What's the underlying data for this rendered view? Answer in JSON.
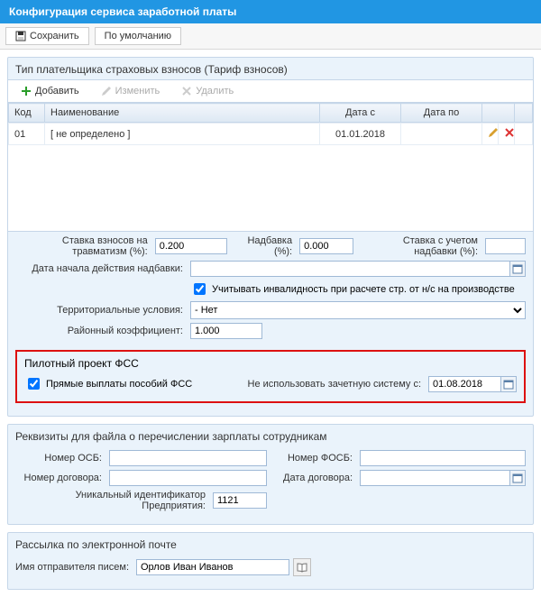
{
  "title": "Конфигурация сервиса заработной платы",
  "toolbar": {
    "save_label": "Сохранить",
    "default_label": "По умолчанию"
  },
  "payer_section": {
    "title": "Тип плательщика страховых взносов (Тариф взносов)",
    "add_label": "Добавить",
    "edit_label": "Изменить",
    "delete_label": "Удалить",
    "columns": {
      "code": "Код",
      "name": "Наименование",
      "date_from": "Дата с",
      "date_to": "Дата по"
    },
    "rows": [
      {
        "code": "01",
        "name": "[ не определено ]",
        "date_from": "01.01.2018",
        "date_to": ""
      }
    ]
  },
  "rates": {
    "injury_label": "Ставка взносов на травматизм (%):",
    "injury_value": "0.200",
    "surcharge_label": "Надбавка (%):",
    "surcharge_value": "0.000",
    "rate_with_surcharge_label": "Ставка с учетом надбавки (%):",
    "rate_with_surcharge_value": "",
    "surcharge_start_label": "Дата начала действия надбавки:",
    "surcharge_start_value": "",
    "disability_checkbox_label": "Учитывать инвалидность при расчете стр. от н/с на производстве",
    "terr_label": "Территориальные условия:",
    "terr_value": "- Нет",
    "district_coef_label": "Районный коэффициент:",
    "district_coef_value": "1.000"
  },
  "pilot": {
    "title": "Пилотный проект ФСС",
    "direct_payments_label": "Прямые выплаты пособий ФСС",
    "no_offset_label": "Не использовать зачетную систему с:",
    "no_offset_date": "01.08.2018"
  },
  "transfer": {
    "title": "Реквизиты для файла о перечислении зарплаты сотрудникам",
    "osb_label": "Номер ОСБ:",
    "osb_value": "",
    "fosb_label": "Номер ФОСБ:",
    "fosb_value": "",
    "contract_num_label": "Номер договора:",
    "contract_num_value": "",
    "contract_date_label": "Дата договора:",
    "contract_date_value": "",
    "enterprise_id_label": "Уникальный идентификатор Предприятия:",
    "enterprise_id_value": "1121"
  },
  "email": {
    "title": "Рассылка по электронной почте",
    "sender_label": "Имя отправителя писем:",
    "sender_value": "Орлов Иван Иванов"
  }
}
